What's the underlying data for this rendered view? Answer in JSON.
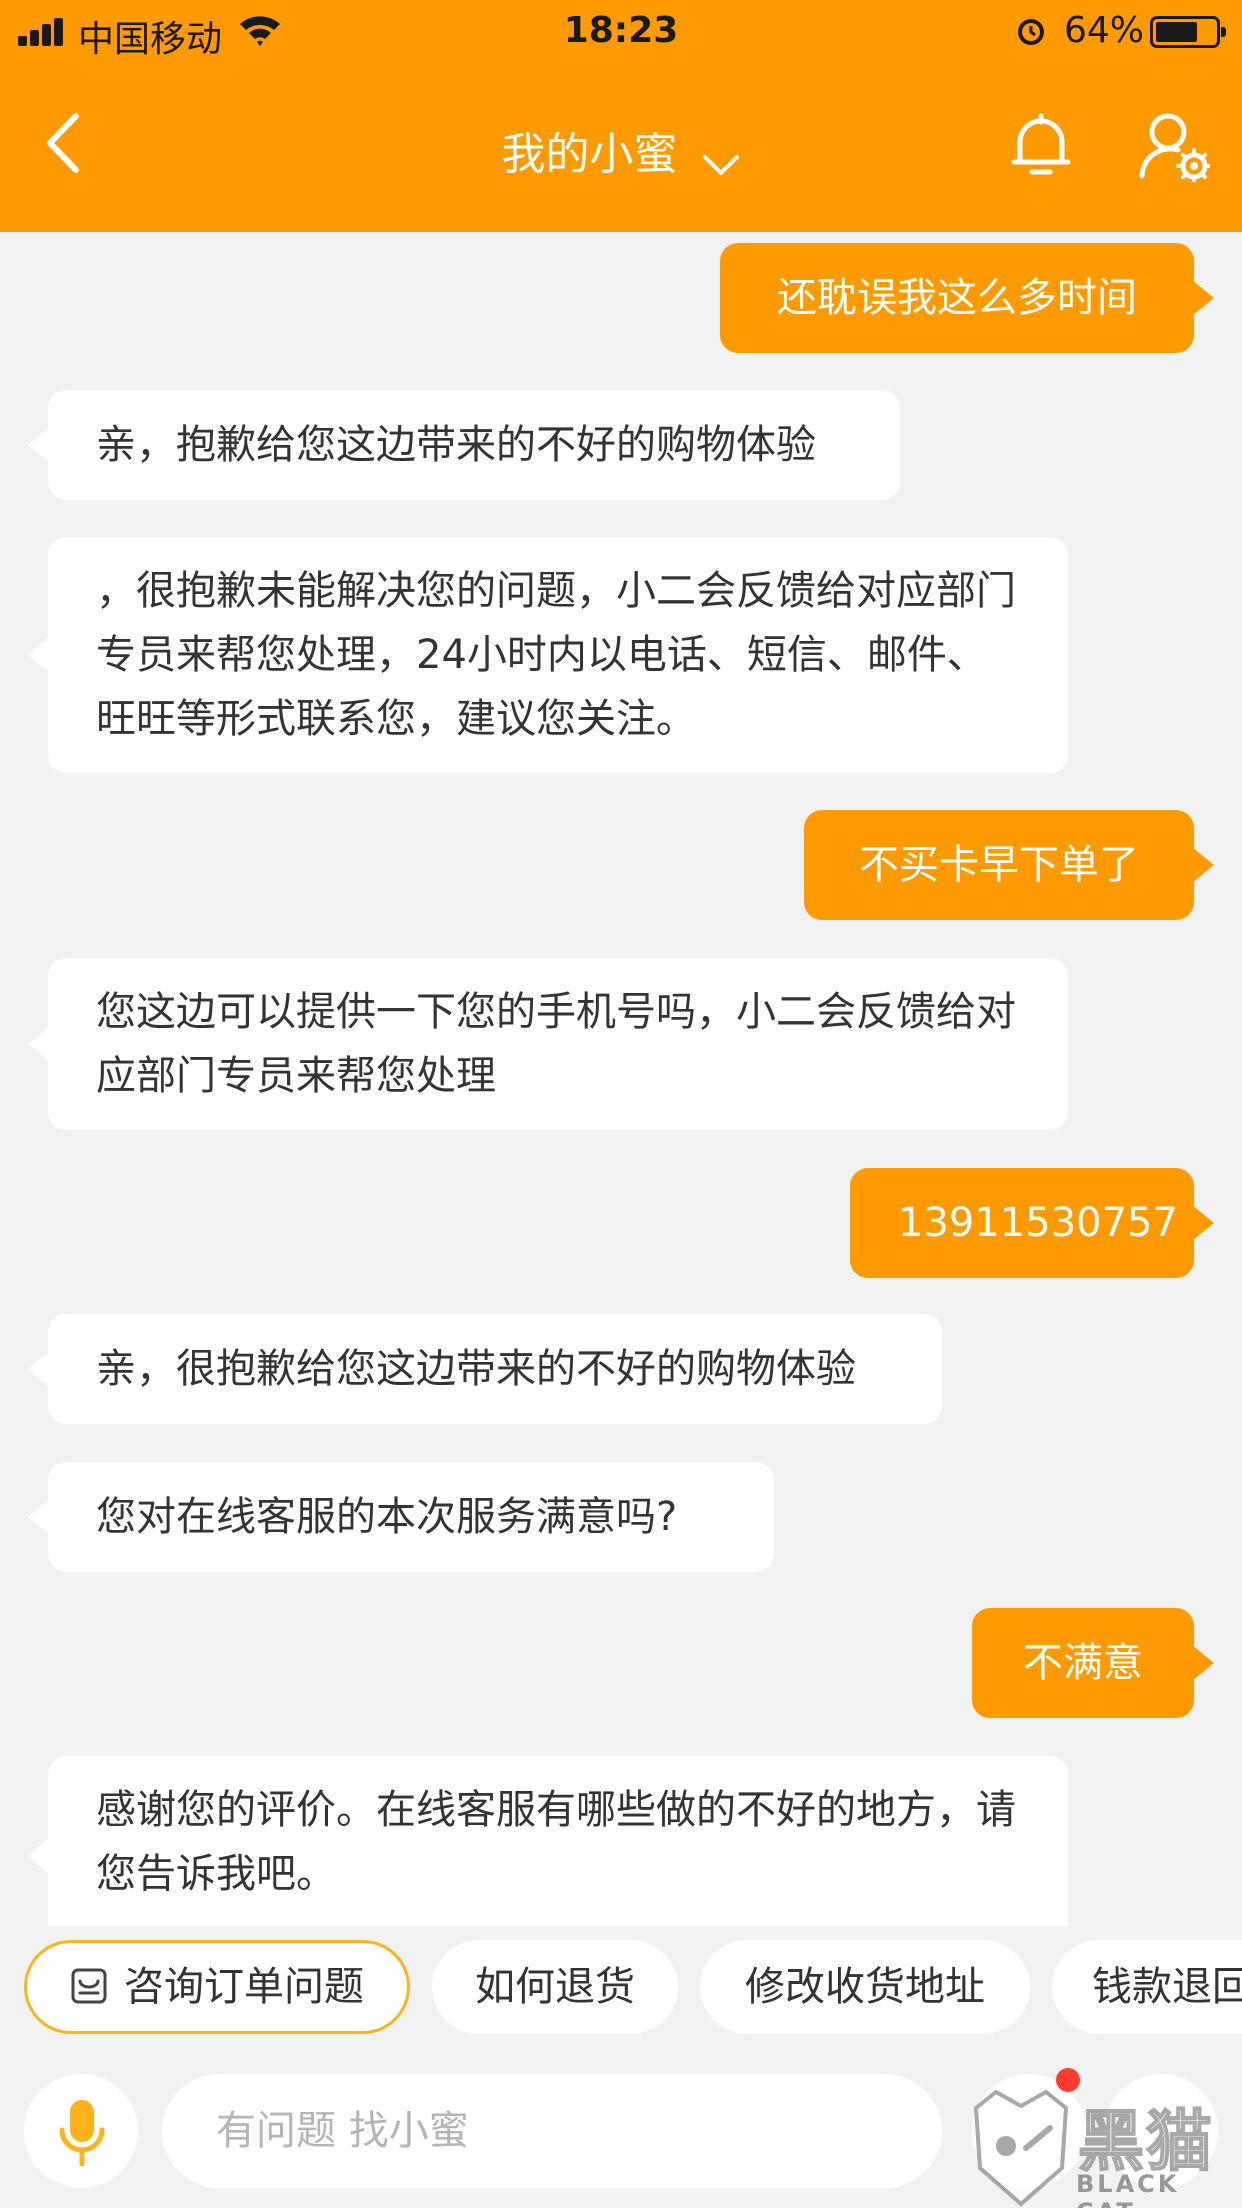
{
  "status_bar": {
    "carrier": "中国移动",
    "time": "18:23",
    "battery": "64%"
  },
  "nav": {
    "title": "我的小蜜"
  },
  "messages": [
    {
      "side": "right",
      "text": "还耽误我这么多时间"
    },
    {
      "side": "left",
      "text": "亲，抱歉给您这边带来的不好的购物体验"
    },
    {
      "side": "left",
      "text": "，很抱歉未能解决您的问题，小二会反馈给对应部门专员来帮您处理，24小时内以电话、短信、邮件、旺旺等形式联系您，建议您关注。"
    },
    {
      "side": "right",
      "text": "不买卡早下单了"
    },
    {
      "side": "left",
      "text": "您这边可以提供一下您的手机号吗，小二会反馈给对应部门专员来帮您处理"
    },
    {
      "side": "right",
      "text": "13911530757"
    },
    {
      "side": "left",
      "text": "亲，很抱歉给您这边带来的不好的购物体验"
    },
    {
      "side": "left",
      "text": "您对在线客服的本次服务满意吗?"
    },
    {
      "side": "right",
      "text": "不满意"
    },
    {
      "side": "left",
      "text": "感谢您的评价。在线客服有哪些做的不好的地方，请您告诉我吧。"
    }
  ],
  "quick_replies": [
    "咨询订单问题",
    "如何退货",
    "修改收货地址",
    "钱款退回"
  ],
  "input": {
    "placeholder": "有问题 找小蜜"
  },
  "watermark": {
    "text": "黑猫",
    "subtext": "BLACK CAT"
  },
  "colors": {
    "accent": "#ff9a00",
    "background": "#f2f2f2",
    "bubble_left": "#ffffff"
  },
  "icons": [
    "back-arrow-icon",
    "chevron-down-icon",
    "bell-icon",
    "user-settings-icon",
    "order-icon",
    "microphone-icon"
  ]
}
